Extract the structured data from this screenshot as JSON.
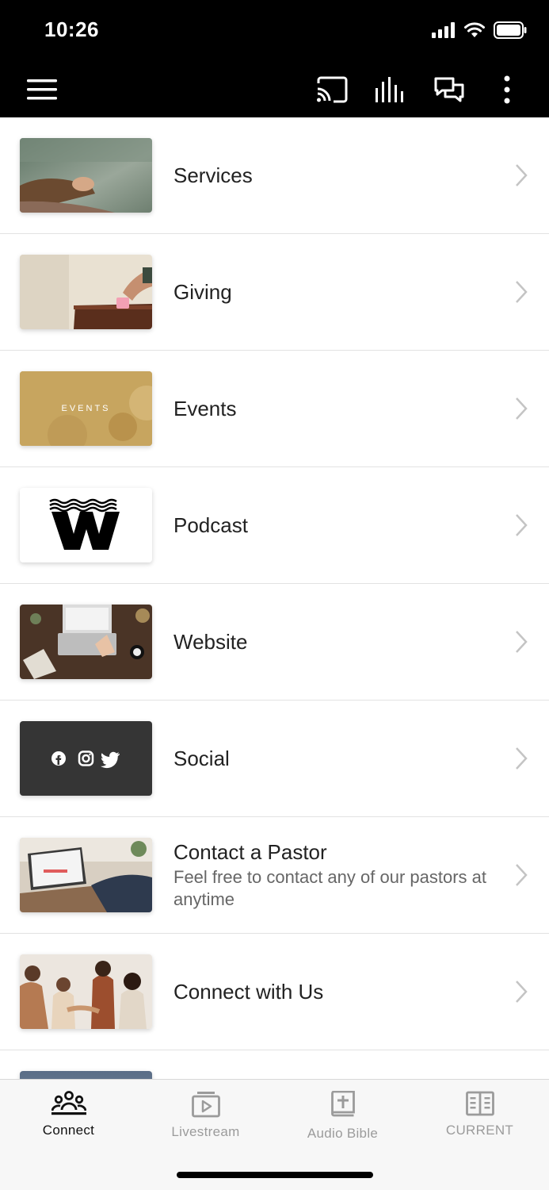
{
  "status_bar": {
    "time": "10:26"
  },
  "app_bar": {
    "icons": [
      "menu-icon",
      "cast-icon",
      "audio-bars-icon",
      "chat-icon",
      "more-vertical-icon"
    ]
  },
  "list": {
    "items": [
      {
        "title": "Services",
        "subtitle": "",
        "thumb_icon": "praying-hands-photo"
      },
      {
        "title": "Giving",
        "subtitle": "",
        "thumb_icon": "giving-hand-photo"
      },
      {
        "title": "Events",
        "subtitle": "",
        "thumb_icon": "events-photo",
        "thumb_text": "EVENTS"
      },
      {
        "title": "Podcast",
        "subtitle": "",
        "thumb_icon": "w-logo"
      },
      {
        "title": "Website",
        "subtitle": "",
        "thumb_icon": "laptop-desk-photo"
      },
      {
        "title": "Social",
        "subtitle": "",
        "thumb_icon": "social-icons"
      },
      {
        "title": "Contact a Pastor",
        "subtitle": "Feel free to contact any of our pastors at anytime",
        "thumb_icon": "laptop-typing-photo"
      },
      {
        "title": "Connect with Us",
        "subtitle": "",
        "thumb_icon": "people-handshake-photo"
      }
    ]
  },
  "tabs": [
    {
      "label": "Connect",
      "icon": "people-group-icon",
      "active": true
    },
    {
      "label": "Livestream",
      "icon": "play-stack-icon",
      "active": false
    },
    {
      "label": "Audio Bible",
      "icon": "bible-icon",
      "active": false
    },
    {
      "label": "CURRENT",
      "icon": "open-book-icon",
      "active": false
    }
  ],
  "colors": {
    "bar_bg": "#000000",
    "divider": "#e2e2e2",
    "tab_active": "#111111",
    "tab_inactive": "#9b9b9b"
  }
}
